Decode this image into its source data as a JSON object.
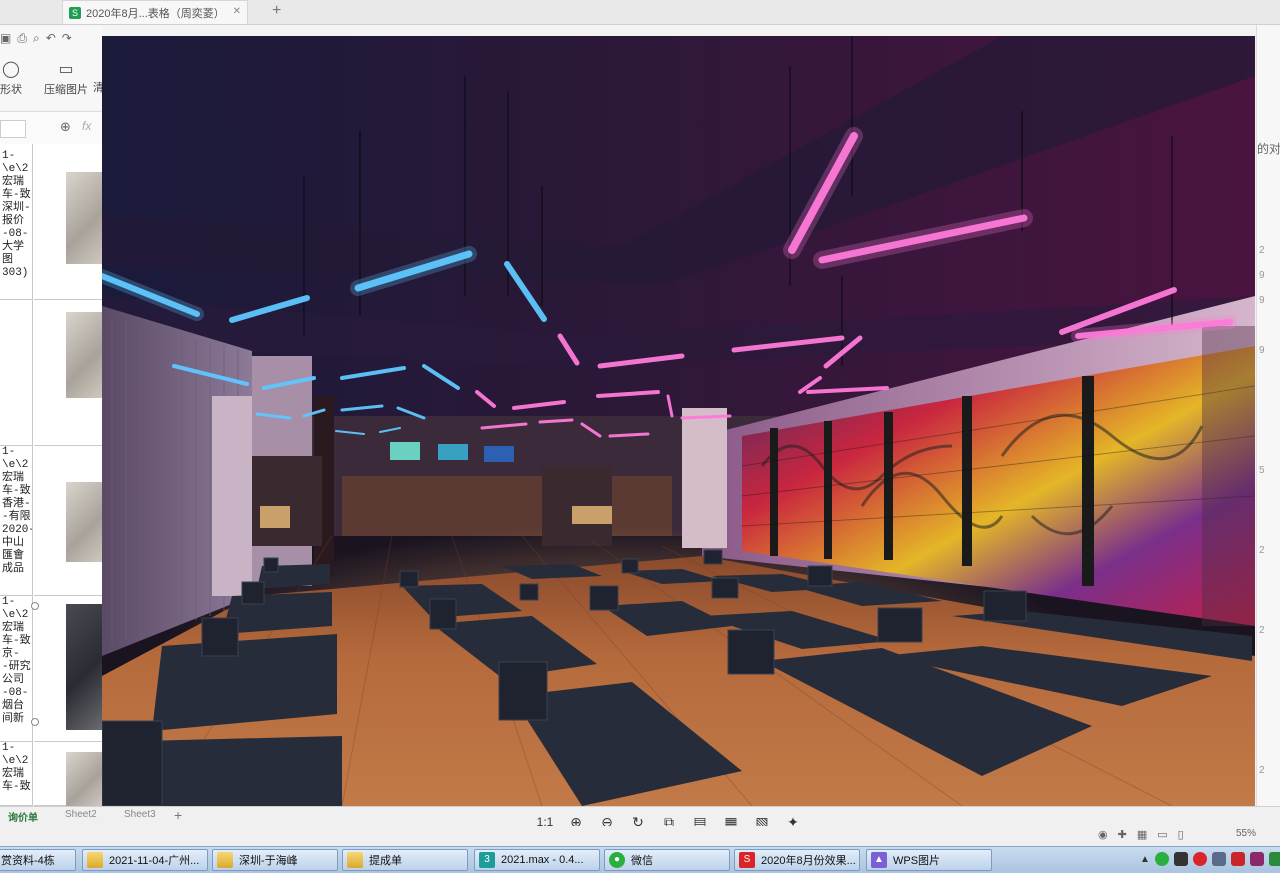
{
  "tabstrip": {
    "doc_title": "2020年8月...表格（周奕菱）",
    "close": "✕",
    "plus": "+"
  },
  "toolbar": {
    "shape_label": "形状",
    "compress_label": "压缩图片",
    "extra_label": "清"
  },
  "formula": {
    "fx": "fx"
  },
  "sheet": {
    "rows": [
      {
        "text": "1-\n\\e\\2\n宏瑞\n车-致\n深圳-\n报价\n-08-\n大学\n图\n303)"
      },
      {
        "text": "\n\n\n\n\n\n"
      },
      {
        "text": "1-\n\\e\\2\n宏瑞\n车-致\n香港-\n-有限\n2020-\n中山\n匯會\n成品"
      },
      {
        "text": "1-\n\\e\\2\n宏瑞\n车-致\n京-\n-研究\n公司\n-08-\n烟台\n间新"
      },
      {
        "text": "1-\n\\e\\2\n宏瑞\n车-致"
      }
    ],
    "tabs": [
      "询价单",
      "Sheet2",
      "Sheet3"
    ],
    "add_tab": "+"
  },
  "right_strip": {
    "text": "的对",
    "numbers": [
      "2",
      "9",
      "9",
      "9",
      "5",
      "2",
      "2",
      "2"
    ]
  },
  "viewer": {
    "toolbar": {
      "actual_size": "1:1"
    }
  },
  "status": {
    "zoom": "55%"
  },
  "taskbar": {
    "items": [
      {
        "label": "赏资料-4栋"
      },
      {
        "label": "2021-11-04-广州..."
      },
      {
        "label": "深圳-于海峰"
      },
      {
        "label": "提成单"
      },
      {
        "label": "2021.max - 0.4..."
      },
      {
        "label": "微信"
      },
      {
        "label": "2020年8月份效果..."
      },
      {
        "label": "WPS图片"
      }
    ]
  },
  "colors": {
    "neon_blue": "#5ec8ff",
    "neon_pink": "#ff7ad9",
    "floor_wood": "#b5703f",
    "mat": "#262c3a"
  }
}
